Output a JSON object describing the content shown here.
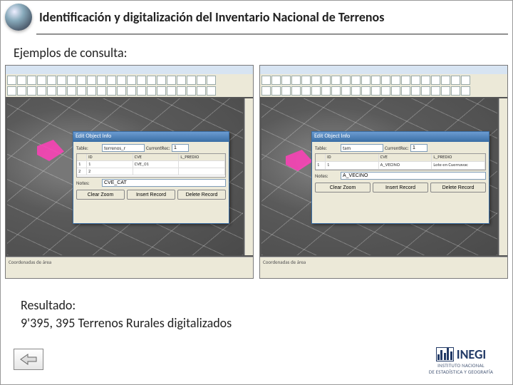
{
  "header": {
    "title": "Identificación y digitalización del Inventario Nacional de Terrenos"
  },
  "subheading": "Ejemplos de consulta:",
  "screenshots": [
    {
      "dialog": {
        "title": "Edit Object Info",
        "table_label": "Table:",
        "table_value": "terrenos_r",
        "current_label": "CurrentRec:",
        "current_value": "1",
        "grid_headers": [
          "",
          "ID",
          "CVE",
          "L_PREDIO"
        ],
        "grid_rows": [
          [
            "1",
            "1",
            "CVE_01",
            ""
          ],
          [
            "2",
            "2",
            "",
            ""
          ]
        ],
        "notes_label": "Notes:",
        "notes_value": "CVE_CAT",
        "buttons": [
          "Clear Zoom",
          "Insert Record",
          "Delete Record"
        ]
      }
    },
    {
      "dialog": {
        "title": "Edit Object Info",
        "table_label": "Table:",
        "table_value": "tam",
        "current_label": "CurrentRec:",
        "current_value": "1",
        "grid_headers": [
          "",
          "ID",
          "CVE",
          "L_PREDIO"
        ],
        "grid_rows": [
          [
            "1",
            "1",
            "A_VECINO",
            "Lote en Cuernavac"
          ]
        ],
        "notes_label": "Notes:",
        "notes_value": "A_VECINO",
        "buttons": [
          "Clear Zoom",
          "Insert Record",
          "Delete Record"
        ]
      }
    }
  ],
  "result": {
    "label": "Resultado:",
    "value": "9'395, 395 Terrenos Rurales digitalizados"
  },
  "logo": {
    "acronym": "INEGI",
    "line1": "INSTITUTO NACIONAL",
    "line2": "DE ESTADÍSTICA Y GEOGRAFÍA"
  },
  "status_text": "Coordenadas de área"
}
